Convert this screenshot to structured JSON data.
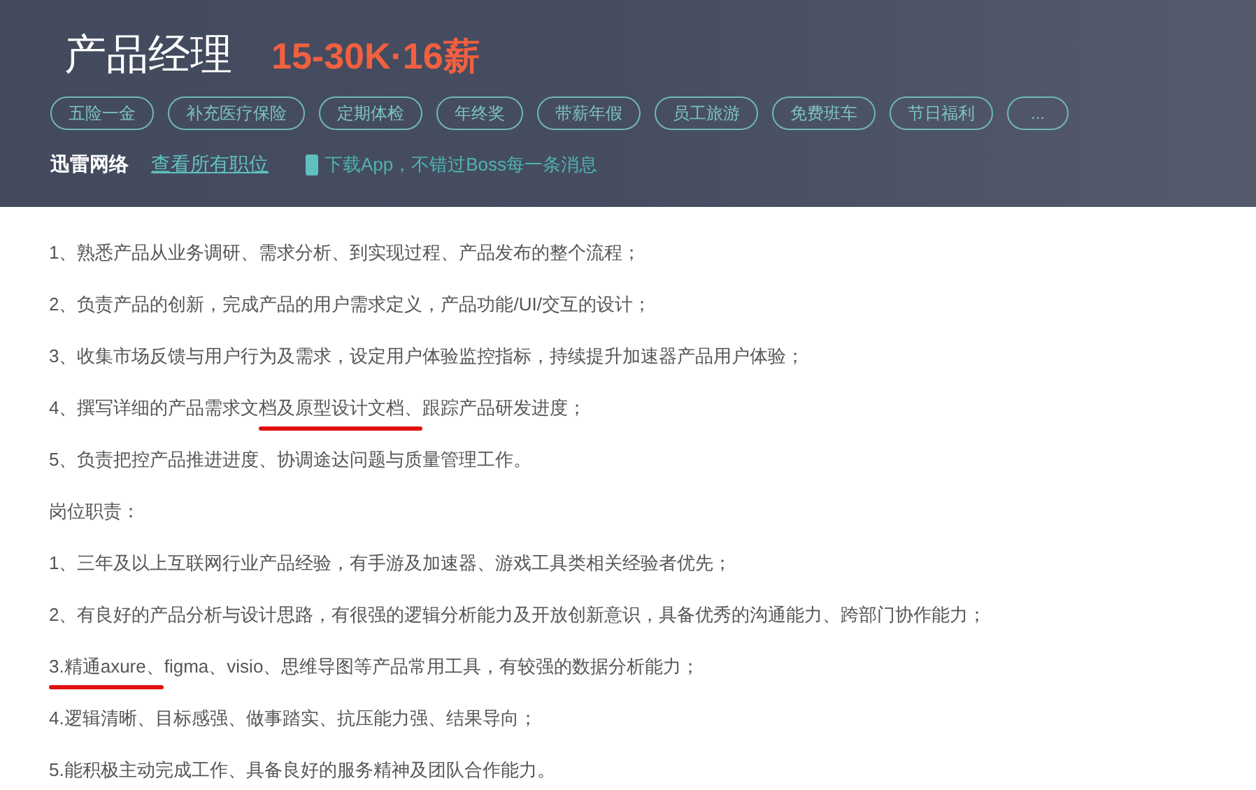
{
  "header": {
    "title": "产品经理",
    "salary": "15-30K·16薪",
    "tags": [
      "五险一金",
      "补充医疗保险",
      "定期体检",
      "年终奖",
      "带薪年假",
      "员工旅游",
      "免费班车",
      "节日福利",
      "..."
    ],
    "company": "迅雷网络",
    "all_jobs_link": "查看所有职位",
    "app_promo": "下载App，不错过Boss每一条消息"
  },
  "description": {
    "lines": [
      [
        {
          "text": "1、熟悉产品从业务调研、需求分析、到实现过程、产品发布的整个流程；",
          "underlined": false
        }
      ],
      [
        {
          "text": "2、负责产品的创新，完成产品的用户需求定义，产品功能/UI/交互的设计；",
          "underlined": false
        }
      ],
      [
        {
          "text": "3、收集市场反馈与用户行为及需求，设定用户体验监控指标，持续提升加速器产品用户体验；",
          "underlined": false
        }
      ],
      [
        {
          "text": "4、撰写详细的产品需求文",
          "underlined": false
        },
        {
          "text": "档及原型设计文档、",
          "underlined": true
        },
        {
          "text": "跟踪产品研发进度；",
          "underlined": false
        }
      ],
      [
        {
          "text": "5、负责把控产品推进进度、协调途达问题与质量管理工作。",
          "underlined": false
        }
      ],
      [
        {
          "text": "岗位职责：",
          "underlined": false
        }
      ],
      [
        {
          "text": "1、三年及以上互联网行业产品经验，有手游及加速器、游戏工具类相关经验者优先；",
          "underlined": false
        }
      ],
      [
        {
          "text": "2、有良好的产品分析与设计思路，有很强的逻辑分析能力及开放创新意识，具备优秀的沟通能力、跨部门协作能力；",
          "underlined": false
        }
      ],
      [
        {
          "text": "3.精通axure、",
          "underlined": true
        },
        {
          "text": "figma、visio、思维导图等产品常用工具，有较强的数据分析能力；",
          "underlined": false
        }
      ],
      [
        {
          "text": "4.逻辑清晰、目标感强、做事踏实、抗压能力强、结果导向；",
          "underlined": false
        }
      ],
      [
        {
          "text": "5.能积极主动完成工作、具备良好的服务精神及团队合作能力。",
          "underlined": false
        }
      ]
    ]
  }
}
